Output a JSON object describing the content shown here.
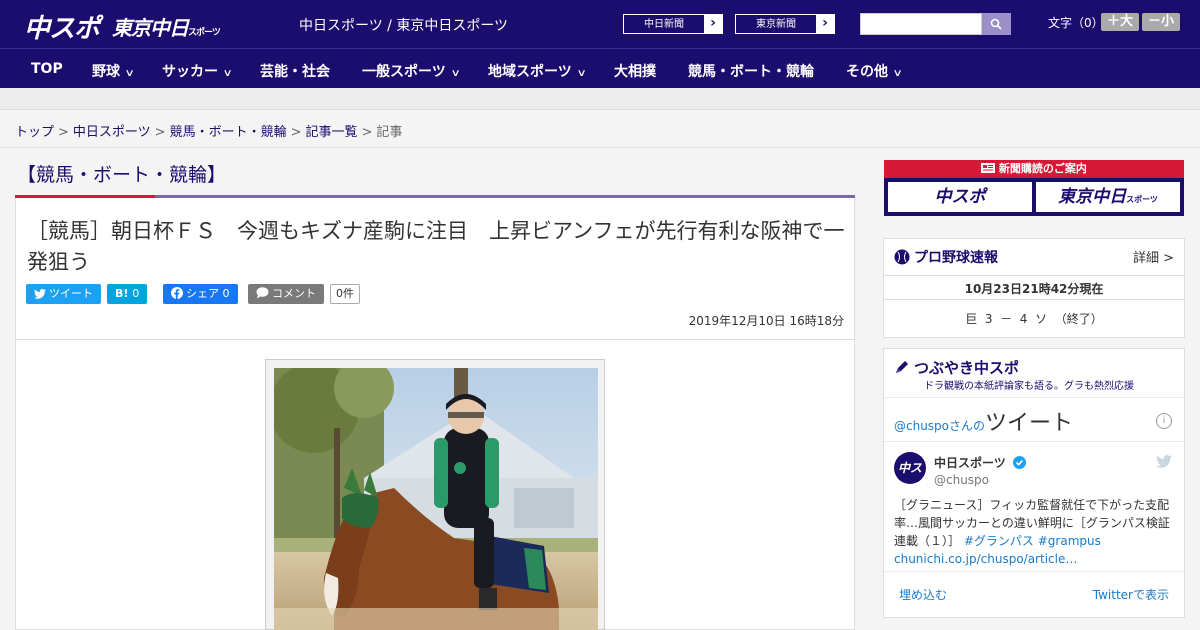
{
  "header": {
    "logo_main": "中スポ",
    "logo_tokyo": "東京中日",
    "logo_tokyo_sub": "スポーツ",
    "site_title": "中日スポーツ / 東京中日スポーツ",
    "ext_links": [
      "中日新聞",
      "東京新聞"
    ],
    "search": {
      "placeholder": ""
    },
    "fontsize_label": "文字（0）",
    "font_plus": "＋大",
    "font_minus": "－小"
  },
  "nav": {
    "items": [
      {
        "label": "TOP",
        "has_menu": false
      },
      {
        "label": "野球",
        "has_menu": true
      },
      {
        "label": "サッカー",
        "has_menu": true
      },
      {
        "label": "芸能・社会",
        "has_menu": false
      },
      {
        "label": "一般スポーツ",
        "has_menu": true
      },
      {
        "label": "地域スポーツ",
        "has_menu": true
      },
      {
        "label": "大相撲",
        "has_menu": false
      },
      {
        "label": "競馬・ボート・競輪",
        "has_menu": false
      },
      {
        "label": "その他",
        "has_menu": true
      }
    ]
  },
  "breadcrumb": {
    "items": [
      "トップ",
      "中日スポーツ",
      "競馬・ボート・競輪",
      "記事一覧"
    ],
    "current": "記事"
  },
  "article": {
    "section": "【競馬・ボート・競輪】",
    "headline": "［競馬］朝日杯ＦＳ　今週もキズナ産駒に注目　上昇ビアンフェが先行有利な阪神で一発狙う",
    "share": {
      "tweet": "ツイート",
      "hatena": "B!",
      "hatena_count": "0",
      "facebook": "シェア",
      "facebook_count": "0",
      "comment": "コメント",
      "comment_count": "0件"
    },
    "date": "2019年12月10日 16時18分"
  },
  "sidebar": {
    "ad": {
      "title": "新聞購読のご案内",
      "btn1": "中スポ",
      "btn2": "東京中日",
      "btn2_sub": "スポーツ"
    },
    "baseball": {
      "title": "プロ野球速報",
      "more": "詳細 >",
      "time": "10月23日21時42分現在",
      "score": "巨  3  －  4  ソ  （終了）"
    },
    "tweets": {
      "title": "つぶやき中スポ",
      "subtitle": "ドラ観戦の本紙評論家も語る。グラも熱烈応援",
      "handle_prefix": "@chuspoさんの",
      "handle_suffix": "ツイート",
      "account_name": "中日スポーツ",
      "account_handle": "@chuspo",
      "tweet_text": "［グラニュース］フィッカ監督就任で下がった支配率…風間サッカーとの違い鮮明に［グランパス検証連載（１）］",
      "hashtag1": "#グランパス",
      "hashtag2": "#grampus",
      "link": "chunichi.co.jp/chuspo/article…",
      "embed": "埋め込む",
      "view_on": "Twitterで表示"
    }
  },
  "colors": {
    "brand": "#1b0d6e",
    "accent_red": "#d41a36",
    "twitter": "#1da1f2",
    "facebook": "#1877f2",
    "hatena": "#00a4de"
  }
}
